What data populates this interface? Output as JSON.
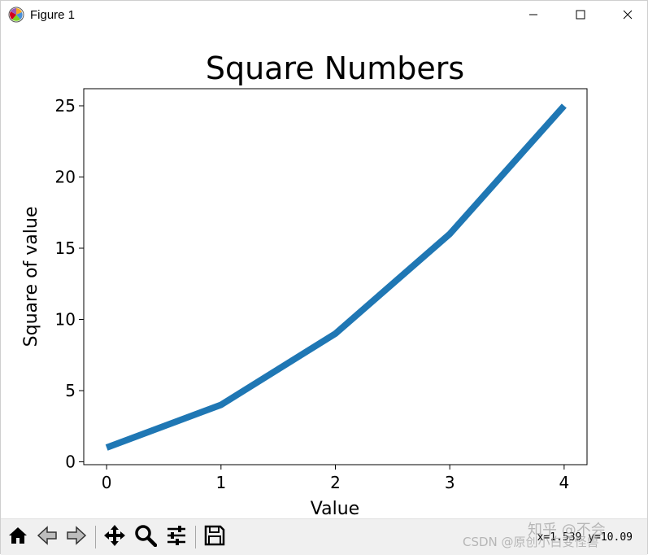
{
  "window": {
    "title": "Figure 1",
    "app_icon": "matplotlib-icon",
    "controls": [
      "minimize-icon",
      "maximize-icon",
      "close-icon"
    ]
  },
  "chart_data": {
    "type": "line",
    "title": "Square Numbers",
    "xlabel": "Value",
    "ylabel": "Square of value",
    "x": [
      0,
      1,
      2,
      3,
      4
    ],
    "series": [
      {
        "values": [
          1,
          4,
          9,
          16,
          25
        ],
        "color": "#1f77b4"
      }
    ],
    "xlim": [
      -0.2,
      4.2
    ],
    "ylim": [
      -0.2,
      26.2
    ],
    "xticks": [
      0,
      1,
      2,
      3,
      4
    ],
    "yticks": [
      0,
      5,
      10,
      15,
      20,
      25
    ],
    "grid": false
  },
  "toolbar": {
    "buttons": [
      "home-icon",
      "back-icon",
      "forward-icon",
      "pan-icon",
      "zoom-icon",
      "configure-icon",
      "save-icon"
    ],
    "coordinates": "x=1.539 y=10.09"
  },
  "watermark": {
    "line1": "知乎 @不会",
    "line2": "CSDN @原创小白变怪兽"
  }
}
